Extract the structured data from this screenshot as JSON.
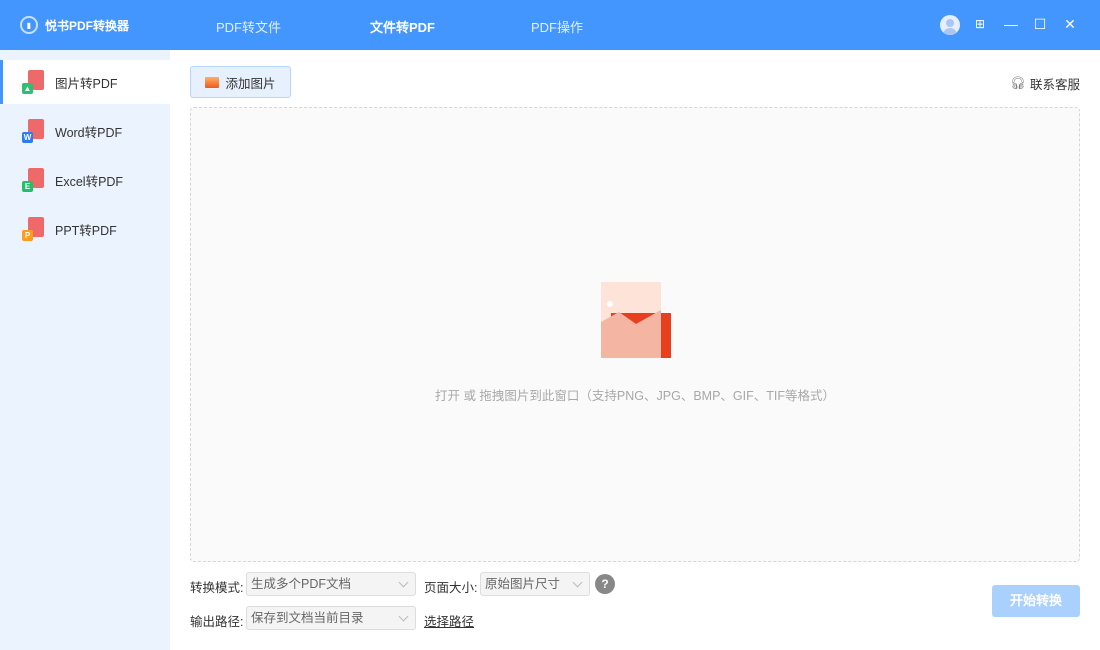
{
  "app": {
    "title": "悦书PDF转换器"
  },
  "tabs": [
    {
      "label": "PDF转文件"
    },
    {
      "label": "文件转PDF"
    },
    {
      "label": "PDF操作"
    }
  ],
  "sidebar": {
    "items": [
      {
        "label": "图片转PDF",
        "badge": "",
        "color": "#2fbf71"
      },
      {
        "label": "Word转PDF",
        "badge": "W",
        "color": "#2b7cf0"
      },
      {
        "label": "Excel转PDF",
        "badge": "E",
        "color": "#23c06a"
      },
      {
        "label": "PPT转PDF",
        "badge": "P",
        "color": "#ff9c1a"
      }
    ]
  },
  "toolbar": {
    "add_label": "添加图片",
    "service_label": "联系客服"
  },
  "dropzone": {
    "hint": "打开 或 拖拽图片到此窗口（支持PNG、JPG、BMP、GIF、TIF等格式）"
  },
  "options": {
    "mode_label": "转换模式:",
    "mode_value": "生成多个PDF文档",
    "size_label": "页面大小:",
    "size_value": "原始图片尺寸",
    "help": "?",
    "path_label": "输出路径:",
    "path_value": "保存到文档当前目录",
    "choose_path": "选择路径"
  },
  "start_label": "开始转换"
}
